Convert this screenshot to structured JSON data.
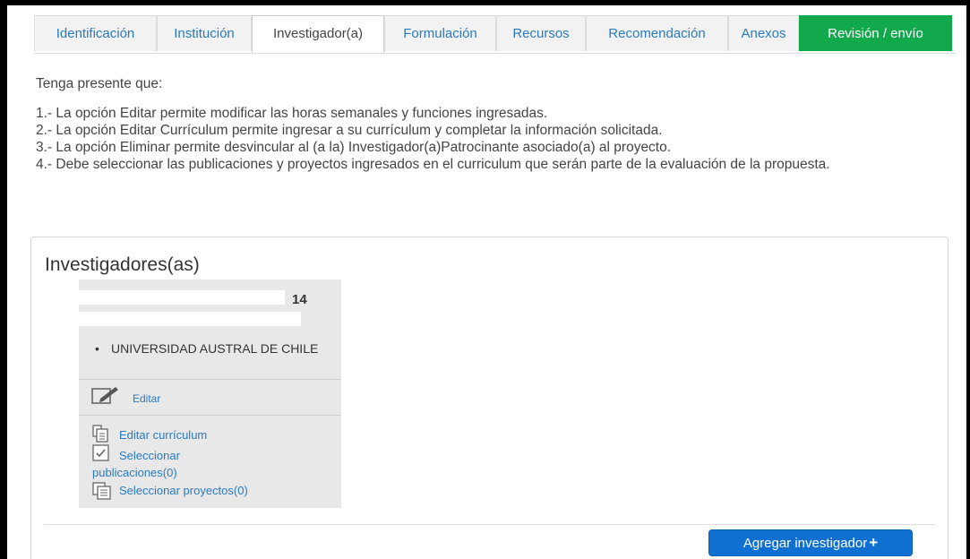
{
  "tabs": [
    {
      "label": "Identificación"
    },
    {
      "label": "Institución"
    },
    {
      "label": "Investigador(a)"
    },
    {
      "label": "Formulación"
    },
    {
      "label": "Recursos"
    },
    {
      "label": "Recomendación"
    },
    {
      "label": "Anexos"
    },
    {
      "label": "Revisión / envío"
    }
  ],
  "active_tab": "Investigador(a)",
  "intro": "Tenga presente que:",
  "notes": [
    "1.- La opción Editar permite modificar las horas semanales y funciones ingresadas.",
    "2.- La opción Editar Currículum permite ingresar a su currículum y completar la información solicitada.",
    "3.- La opción Eliminar permite desvincular al (a la) Investigador(a)Patrocinante asociado(a) al proyecto.",
    "4.- Debe seleccionar las publicaciones y proyectos ingresados en el curriculum que serán parte de la evaluación de la propuesta."
  ],
  "panel": {
    "title": "Investigadores(as)",
    "card": {
      "id_suffix": "14",
      "institution": "UNIVERSIDAD AUSTRAL DE CHILE",
      "edit_label": "Editar",
      "edit_cv_label": "Editar currículum",
      "select_pubs_label": "Seleccionar publicaciones(0)",
      "select_projects_label": "Seleccionar proyectos(0)"
    },
    "add_button": "Agregar investigador"
  },
  "colors": {
    "link": "#2a7ac0",
    "green_tab": "#12a84c",
    "primary_button": "#0f70d2"
  }
}
